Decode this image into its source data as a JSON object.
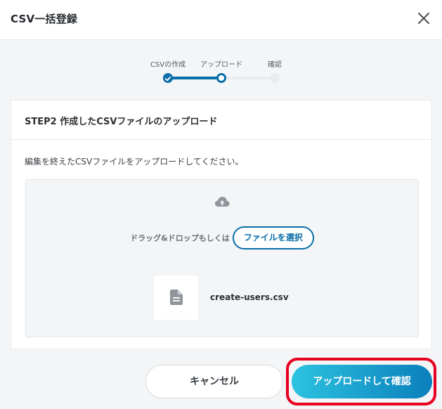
{
  "dialog": {
    "title": "CSV一括登録",
    "close_icon": "close-icon"
  },
  "stepper": {
    "steps": [
      {
        "label": "CSVの作成",
        "state": "done"
      },
      {
        "label": "アップロード",
        "state": "current"
      },
      {
        "label": "確認",
        "state": "todo"
      }
    ]
  },
  "card": {
    "heading": "STEP2 作成したCSVファイルのアップロード",
    "description": "編集を終えたCSVファイルをアップロードしてください。",
    "dropzone": {
      "icon": "cloud-upload-icon",
      "drop_text": "ドラッグ&ドロップもしくは",
      "select_button": "ファイルを選択"
    },
    "file": {
      "icon": "file-icon",
      "name": "create-users.csv"
    }
  },
  "footer": {
    "cancel_label": "キャンセル",
    "confirm_label": "アップロードして確認"
  },
  "colors": {
    "accent": "#0a6ea8",
    "confirm_gradient_start": "#2cc3e0",
    "confirm_gradient_end": "#0b7fbc",
    "highlight": "#e8001f"
  }
}
